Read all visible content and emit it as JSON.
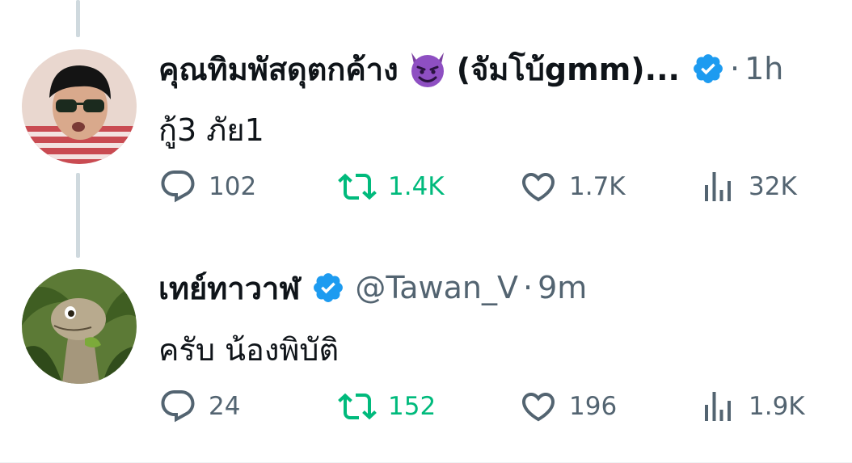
{
  "colors": {
    "text_primary": "#0f1419",
    "text_secondary": "#536471",
    "retweet_green": "#00ba7c",
    "verified_blue": "#1d9bf0",
    "thread_line": "#cfd9de"
  },
  "tweets": [
    {
      "display_name": "คุณทิมพัสดุตกค้าง",
      "name_emoji": "smiling-face-with-horns",
      "name_tail": "(จัมโบ้gmm)...",
      "verified": true,
      "separator": "·",
      "time": "1h",
      "text": "กู้3 ภัย1",
      "replies": "102",
      "retweets": "1.4K",
      "likes": "1.7K",
      "views": "32K"
    },
    {
      "display_name": "เทย์ทาวาฬ",
      "verified": true,
      "handle": "@Tawan_V",
      "separator": "·",
      "time": "9m",
      "text": "ครับ น้องพิบัติ",
      "replies": "24",
      "retweets": "152",
      "likes": "196",
      "views": "1.9K"
    }
  ]
}
